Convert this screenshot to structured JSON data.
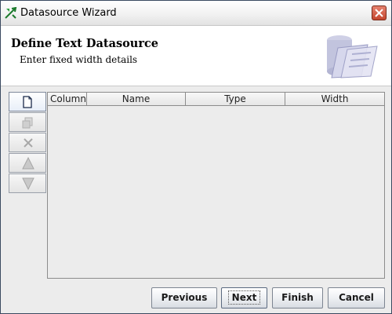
{
  "window": {
    "title": "Datasource Wizard"
  },
  "header": {
    "title": "Define Text Datasource",
    "subtitle": "Enter fixed width details"
  },
  "toolbar": {
    "buttons": [
      {
        "icon": "new-row-icon",
        "enabled": true
      },
      {
        "icon": "copy-row-icon",
        "enabled": false
      },
      {
        "icon": "delete-icon",
        "enabled": false
      },
      {
        "icon": "move-up-icon",
        "enabled": false
      },
      {
        "icon": "move-down-icon",
        "enabled": false
      }
    ]
  },
  "table": {
    "columns": [
      "Column",
      "Name",
      "Type",
      "Width"
    ],
    "rows": []
  },
  "footer": {
    "previous": "Previous",
    "next": "Next",
    "finish": "Finish",
    "cancel": "Cancel"
  },
  "colors": {
    "title_gradient_end": "#e2e2e2",
    "close_button": "#c4462e",
    "panel_background": "#ececec"
  }
}
